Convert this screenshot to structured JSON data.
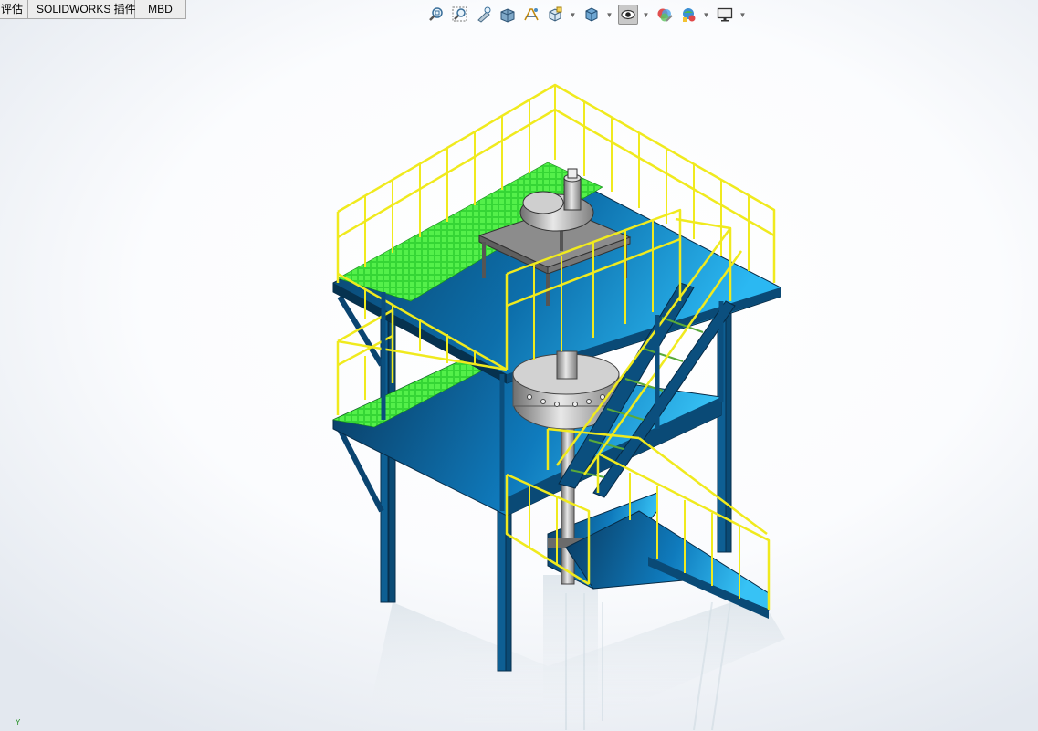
{
  "tabs": [
    {
      "label": "评估"
    },
    {
      "label": "SOLIDWORKS 插件"
    },
    {
      "label": "MBD"
    }
  ],
  "toolbar": {
    "buttons": [
      {
        "icon": "zoom-to-fit-icon"
      },
      {
        "icon": "zoom-to-area-icon"
      },
      {
        "icon": "previous-view-icon"
      },
      {
        "icon": "section-view-icon"
      },
      {
        "icon": "dynamic-annotation-icon"
      },
      {
        "icon": "view-orientation-icon"
      },
      {
        "icon": "display-style-icon"
      },
      {
        "icon": "hide-show-items-icon"
      },
      {
        "icon": "edit-appearance-icon"
      },
      {
        "icon": "apply-scene-icon"
      },
      {
        "icon": "view-settings-icon"
      }
    ]
  },
  "triad": {
    "y_label": "Y"
  },
  "colors": {
    "steel": "#0e6ea8",
    "steel_dark": "#0a3f66",
    "deck": "#1fa3e6",
    "grating": "#3ee03a",
    "railing": "#f2ec2a",
    "vessel": "#9a9a9a"
  }
}
